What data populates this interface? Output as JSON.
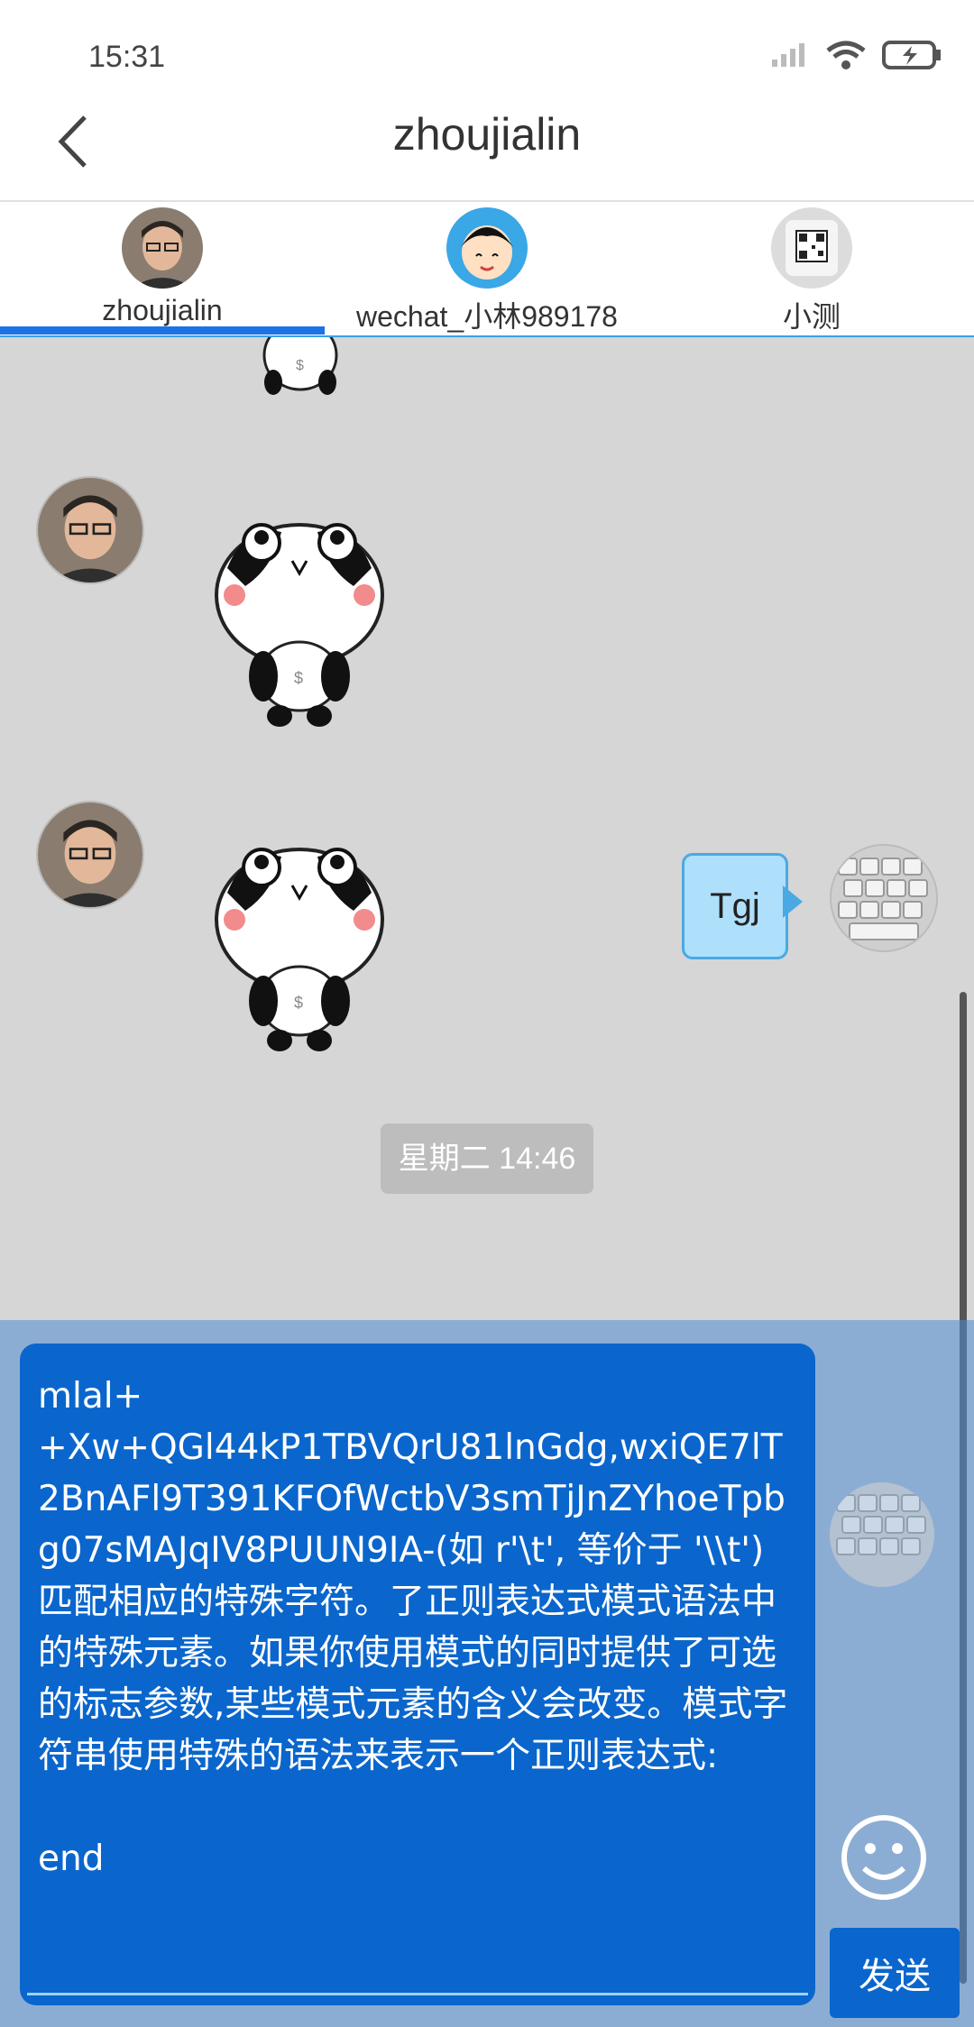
{
  "status_bar": {
    "time": "15:31"
  },
  "header": {
    "title": "zhoujialin"
  },
  "tabs": [
    {
      "label": "zhoujialin"
    },
    {
      "label": "wechat_小林989178"
    },
    {
      "label": "小测"
    }
  ],
  "chat": {
    "timestamp": "星期二 14:46",
    "my_message": "Tgj"
  },
  "composer": {
    "text": "mlal+\n+Xw+QGl44kP1TBVQrU81lnGdg,wxiQE7lT2BnAFl9T391KFOfWctbV3smTjJnZYhoeTpbg07sMAJqIV8PUUN9IA-(如 r'\\t', 等价于 '\\\\t')匹配相应的特殊字符。了正则表达式模式语法中的特殊元素。如果你使用模式的同时提供了可选的标志参数,某些模式元素的含义会改变。模式字符串使用特殊的语法来表示一个正则表达式:\n\nend",
    "send_label": "发送"
  },
  "colors": {
    "accent": "#1a73e8",
    "composer_bg": "#0a66cc",
    "bubble": "#aee0fb",
    "chat_bg": "#d6d6d6"
  }
}
